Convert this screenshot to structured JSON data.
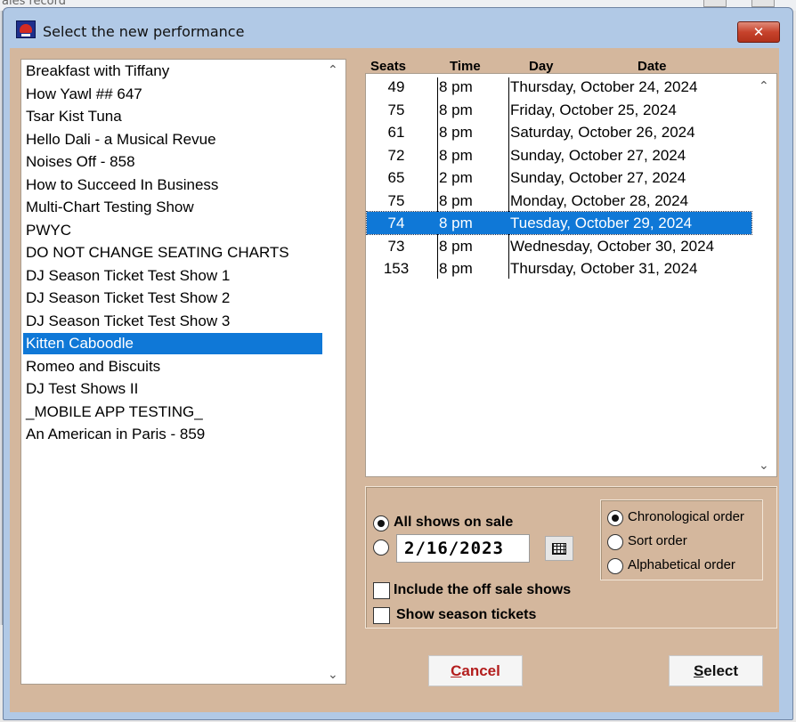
{
  "background": {
    "partial_text": "ales record"
  },
  "dialog": {
    "title": "Select the new performance",
    "close_glyph": "✕"
  },
  "shows": [
    "Breakfast with Tiffany",
    "How Yawl ## 647",
    "Tsar Kist Tuna",
    "Hello Dali - a Musical Revue",
    "Noises Off - 858",
    "How to Succeed In Business",
    "Multi-Chart Testing Show",
    "PWYC",
    "DO NOT CHANGE SEATING CHARTS",
    "DJ Season Ticket Test Show 1",
    "DJ Season Ticket Test Show 2",
    "DJ Season Ticket Test Show 3",
    "Kitten Caboodle",
    "Romeo and Biscuits",
    "DJ Test Shows II",
    "_MOBILE APP TESTING_",
    "An American in Paris - 859"
  ],
  "selected_show": "Kitten Caboodle",
  "columns": {
    "seats": "Seats",
    "time": "Time",
    "day": "Day",
    "date": "Date"
  },
  "performances": [
    {
      "seats": "49",
      "time": "8 pm",
      "date": "Thursday, October 24, 2024"
    },
    {
      "seats": "75",
      "time": "8 pm",
      "date": "Friday, October 25, 2024"
    },
    {
      "seats": "61",
      "time": "8 pm",
      "date": "Saturday, October 26, 2024"
    },
    {
      "seats": "72",
      "time": "8 pm",
      "date": "Sunday, October 27, 2024"
    },
    {
      "seats": "65",
      "time": "2 pm",
      "date": "Sunday, October 27, 2024"
    },
    {
      "seats": "75",
      "time": "8 pm",
      "date": "Monday, October 28, 2024"
    },
    {
      "seats": "74",
      "time": "8 pm",
      "date": "Tuesday, October 29, 2024"
    },
    {
      "seats": "73",
      "time": "8 pm",
      "date": "Wednesday, October 30, 2024"
    },
    {
      "seats": "153",
      "time": "8 pm",
      "date": "Thursday, October 31, 2024"
    }
  ],
  "selected_performance_index": 6,
  "filter": {
    "all_shows_label": "All shows on sale",
    "all_shows_selected": true,
    "date_value": "2/16/2023",
    "date_selected": false
  },
  "sort": {
    "chronological": "Chronological order",
    "sort_order": "Sort order",
    "alphabetical": "Alphabetical order",
    "selected": "chronological"
  },
  "checkboxes": {
    "include_off_sale": "Include the off sale shows",
    "include_off_sale_checked": false,
    "show_season": "Show season tickets",
    "show_season_checked": false
  },
  "buttons": {
    "cancel_accel": "C",
    "cancel_rest": "ancel",
    "select_accel": "S",
    "select_rest": "elect"
  },
  "colors": {
    "accent": "#0f78d7",
    "panel": "#d4b79d",
    "close": "#c7432c"
  }
}
